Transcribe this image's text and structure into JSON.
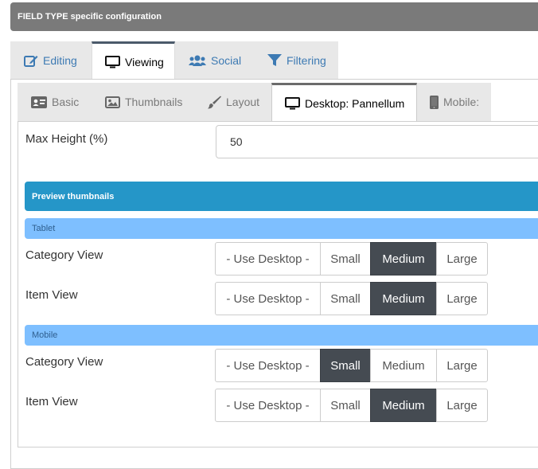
{
  "header": {
    "title": "FIELD TYPE specific configuration"
  },
  "main_tabs": [
    {
      "label": "Editing",
      "icon": "edit-icon"
    },
    {
      "label": "Viewing",
      "icon": "monitor-icon"
    },
    {
      "label": "Social",
      "icon": "users-icon"
    },
    {
      "label": "Filtering",
      "icon": "filter-icon"
    }
  ],
  "main_tabs_active": "Viewing",
  "sub_tabs": [
    {
      "label": "Basic",
      "icon": "id-card-icon"
    },
    {
      "label": "Thumbnails",
      "icon": "image-icon"
    },
    {
      "label": "Layout",
      "icon": "brush-icon"
    },
    {
      "label": "Desktop: Pannellum",
      "icon": "monitor-icon"
    },
    {
      "label": "Mobile:",
      "icon": "mobile-icon"
    }
  ],
  "sub_tabs_active": "Desktop: Pannellum",
  "max_height": {
    "label": "Max Height (%)",
    "value": "50"
  },
  "preview_section": {
    "title": "Preview thumbnails"
  },
  "size_options": [
    "- Use Desktop -",
    "Small",
    "Medium",
    "Large"
  ],
  "tablet": {
    "title": "Tablet",
    "category_view": {
      "label": "Category View",
      "selected": "Medium"
    },
    "item_view": {
      "label": "Item View",
      "selected": "Medium"
    }
  },
  "mobile": {
    "title": "Mobile",
    "category_view": {
      "label": "Category View",
      "selected": "Small"
    },
    "item_view": {
      "label": "Item View",
      "selected": "Medium"
    }
  },
  "colors": {
    "header_bg": "#7a7a7a",
    "section_bg": "#2596c8",
    "subsection_bg": "#7ebfff",
    "selected_btn_bg": "#454b52",
    "tab_link": "#3d7ab3"
  }
}
